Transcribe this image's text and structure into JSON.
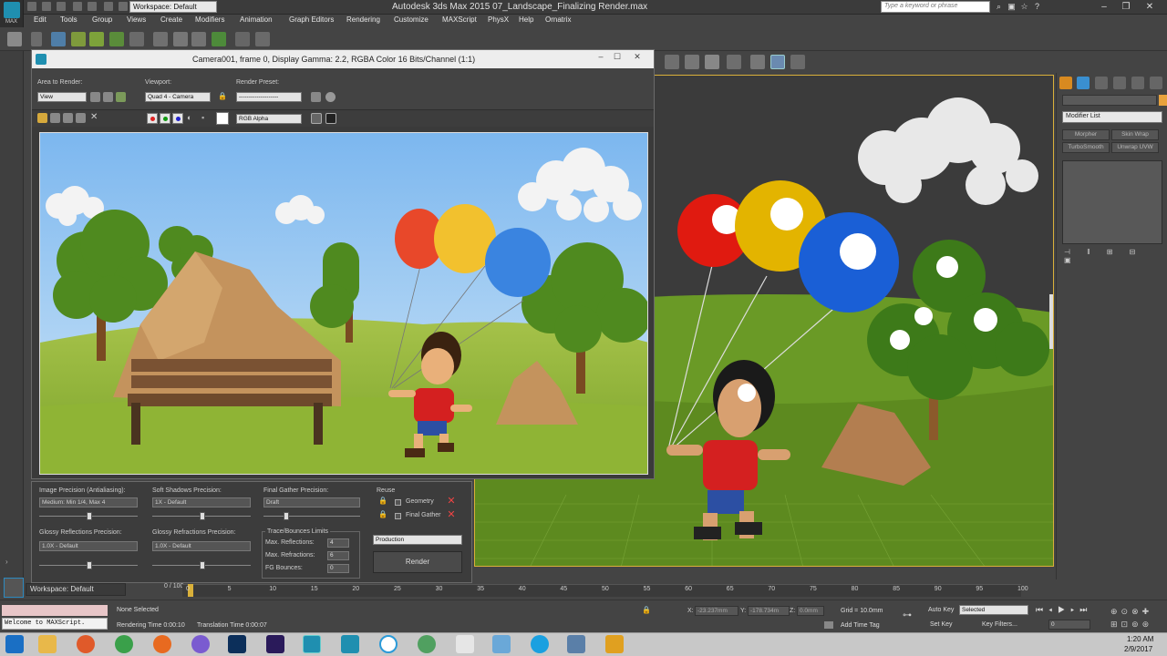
{
  "title_bar": {
    "app_title": "Autodesk 3ds Max  2015     07_Landscape_Finalizing Render.max",
    "workspace": "Workspace: Default",
    "search_placeholder": "Type a keyword or phrase",
    "logo_text": "MAX"
  },
  "menu": [
    "Edit",
    "Tools",
    "Group",
    "Views",
    "Create",
    "Modifiers",
    "Animation",
    "Graph Editors",
    "Rendering",
    "Customize",
    "MAXScript",
    "PhysX",
    "Help",
    "Ornatrix"
  ],
  "render_window": {
    "title": "Camera001, frame 0, Display Gamma: 2.2, RGBA Color 16 Bits/Channel (1:1)",
    "area_label": "Area to Render:",
    "area_value": "View",
    "viewport_label": "Viewport:",
    "viewport_value": "Quad 4 - Camera",
    "preset_label": "Render Preset:",
    "preset_value": "--------------------",
    "channel_value": "RGB Alpha"
  },
  "render_settings": {
    "image_precision_label": "Image Precision (Antialiasing):",
    "image_precision_value": "Medium: Min 1/4, Max 4",
    "soft_shadows_label": "Soft Shadows Precision:",
    "soft_shadows_value": "1X - Default",
    "final_gather_label": "Final Gather Precision:",
    "final_gather_value": "Draft",
    "reuse_label": "Reuse",
    "geometry_label": "Geometry",
    "final_gather_reuse_label": "Final Gather",
    "glossy_reflections_label": "Glossy Reflections Precision:",
    "glossy_reflections_value": "1.0X - Default",
    "glossy_refractions_label": "Glossy Refractions Precision:",
    "glossy_refractions_value": "1.0X - Default",
    "trace_label": "Trace/Bounces Limits",
    "max_reflections_label": "Max. Reflections:",
    "max_reflections_value": "4",
    "max_refractions_label": "Max. Refractions:",
    "max_refractions_value": "6",
    "fg_bounces_label": "FG Bounces:",
    "fg_bounces_value": "0",
    "production_value": "Production",
    "render_button": "Render"
  },
  "command_panel": {
    "modifier_list": "Modifier List",
    "buttons": [
      "Morpher",
      "Skin Wrap",
      "TurboSmooth",
      "Unwrap UVW"
    ]
  },
  "timeline": {
    "frame_counter": "0 / 100",
    "ticks": [
      "0",
      "5",
      "10",
      "15",
      "20",
      "25",
      "30",
      "35",
      "40",
      "45",
      "50",
      "55",
      "60",
      "65",
      "70",
      "75",
      "80",
      "85",
      "90",
      "95",
      "100"
    ],
    "workspace_bottom": "Workspace: Default"
  },
  "status": {
    "maxscript": "Welcome to MAXScript.",
    "selection": "None Selected",
    "rendering_time": "Rendering Time  0:00:10",
    "translation_time": "Translation Time  0:00:07",
    "x_label": "X:",
    "x_value": "-23.237mm",
    "y_label": "Y:",
    "y_value": "-178.734m",
    "z_label": "Z:",
    "z_value": "0.0mm",
    "grid": "Grid = 10.0mm",
    "add_time_tag": "Add Time Tag",
    "auto_key": "Auto Key",
    "selected": "Selected",
    "set_key": "Set Key",
    "key_filters": "Key Filters...",
    "frame_value": "0"
  },
  "taskbar": {
    "time": "1:20 AM",
    "date": "2/9/2017"
  },
  "colors": {
    "viewport_border": "#d9b03a",
    "accent": "#1f8fb0"
  }
}
